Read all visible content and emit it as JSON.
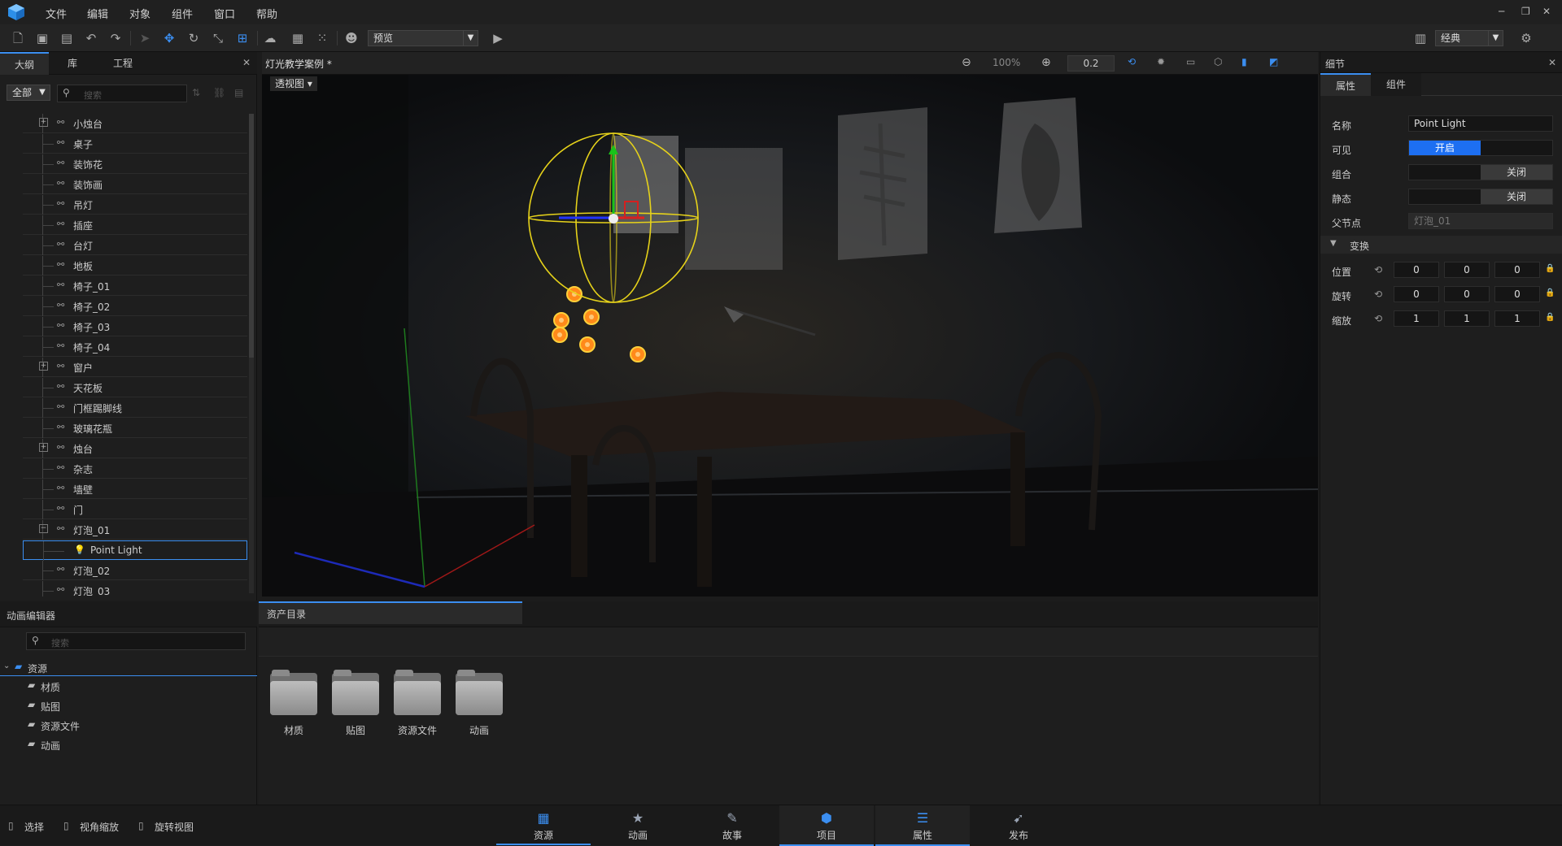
{
  "menu": {
    "items": [
      "文件",
      "编辑",
      "对象",
      "组件",
      "窗口",
      "帮助"
    ]
  },
  "toolbar": {
    "preview_label": "预览",
    "layout_label": "经典"
  },
  "left_panel": {
    "tabs": [
      "大纲",
      "库",
      "工程"
    ],
    "filter_label": "全部",
    "search_placeholder": "搜索",
    "tree": [
      {
        "label": "小烛台",
        "expand": "+"
      },
      {
        "label": "桌子",
        "expand": ""
      },
      {
        "label": "装饰花",
        "expand": ""
      },
      {
        "label": "装饰画",
        "expand": ""
      },
      {
        "label": "吊灯",
        "expand": ""
      },
      {
        "label": "插座",
        "expand": ""
      },
      {
        "label": "台灯",
        "expand": ""
      },
      {
        "label": "地板",
        "expand": ""
      },
      {
        "label": "椅子_01",
        "expand": ""
      },
      {
        "label": "椅子_02",
        "expand": ""
      },
      {
        "label": "椅子_03",
        "expand": ""
      },
      {
        "label": "椅子_04",
        "expand": ""
      },
      {
        "label": "窗户",
        "expand": "+"
      },
      {
        "label": "天花板",
        "expand": ""
      },
      {
        "label": "门框踢脚线",
        "expand": ""
      },
      {
        "label": "玻璃花瓶",
        "expand": ""
      },
      {
        "label": "烛台",
        "expand": "+"
      },
      {
        "label": "杂志",
        "expand": ""
      },
      {
        "label": "墙壁",
        "expand": ""
      },
      {
        "label": "门",
        "expand": ""
      },
      {
        "label": "灯泡_01",
        "expand": "−"
      },
      {
        "label": "Point Light",
        "expand": "",
        "selected": true
      },
      {
        "label": "灯泡_02",
        "expand": ""
      },
      {
        "label": "灯泡_03",
        "expand": ""
      }
    ]
  },
  "viewport": {
    "title": "灯光教学案例 *",
    "view_mode": "透视图",
    "zoom": "100%",
    "snap_value": "0.2"
  },
  "right_panel": {
    "title": "细节",
    "tabs": [
      "属性",
      "组件"
    ],
    "name_label": "名称",
    "name_value": "Point Light",
    "visible_label": "可见",
    "visible_value": "开启",
    "group_label": "组合",
    "group_value": "关闭",
    "static_label": "静态",
    "static_value": "关闭",
    "parent_label": "父节点",
    "parent_value": "灯泡_01",
    "transform_label": "变换",
    "position_label": "位置",
    "position": [
      "0",
      "0",
      "0"
    ],
    "rotation_label": "旋转",
    "rotation": [
      "0",
      "0",
      "0"
    ],
    "scale_label": "缩放",
    "scale": [
      "1",
      "1",
      "1"
    ]
  },
  "anim_panel": {
    "title": "动画编辑器",
    "search_placeholder": "搜索",
    "root": "资源",
    "children": [
      "材质",
      "贴图",
      "资源文件",
      "动画"
    ]
  },
  "assets": {
    "tab": "资产目录",
    "folders": [
      "材质",
      "贴图",
      "资源文件",
      "动画"
    ]
  },
  "status": {
    "hints": [
      "选择",
      "视角缩放",
      "旋转视图"
    ],
    "tabs": [
      "资源",
      "动画",
      "故事",
      "项目",
      "属性",
      "发布"
    ]
  }
}
